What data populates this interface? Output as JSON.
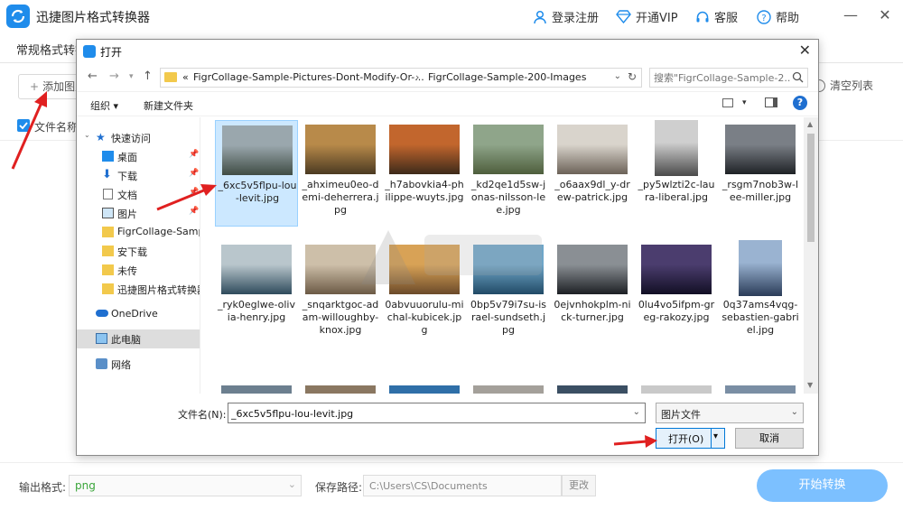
{
  "app": {
    "title": "迅捷图片格式转换器",
    "links": {
      "login": "登录注册",
      "vip": "开通VIP",
      "service": "客服",
      "help": "帮助"
    },
    "tab_label": "常规格式转换",
    "add_button": "添加图片",
    "clear_button": "清空列表",
    "list_header": "文件名称",
    "output_label": "输出格式:",
    "output_value": "png",
    "save_label": "保存路径:",
    "save_path": "C:\\Users\\CS\\Documents",
    "change_button": "更改",
    "start_button": "开始转换"
  },
  "dialog": {
    "title": "打开",
    "breadcrumb": {
      "prefix": "«",
      "part1": "FigrCollage-Sample-Pictures-Dont-Modify-Or-...",
      "sep": "›",
      "part2": "FigrCollage-Sample-200-Images"
    },
    "search_placeholder": "搜索\"FigrCollage-Sample-2...",
    "organize": "组织 ▾",
    "new_folder": "新建文件夹",
    "help_glyph": "?",
    "nav": [
      {
        "label": "快速访问",
        "icon": "star-icon"
      },
      {
        "label": "桌面",
        "icon": "desktop-icon",
        "pinned": true
      },
      {
        "label": "下载",
        "icon": "download-icon",
        "pinned": true
      },
      {
        "label": "文档",
        "icon": "document-icon",
        "pinned": true
      },
      {
        "label": "图片",
        "icon": "picture-icon",
        "pinned": true
      },
      {
        "label": "FigrCollage-Samp",
        "icon": "folder-icon"
      },
      {
        "label": "安下载",
        "icon": "folder-icon"
      },
      {
        "label": "未传",
        "icon": "folder-icon"
      },
      {
        "label": "迅捷图片格式转换器",
        "icon": "folder-icon"
      },
      {
        "label": "OneDrive",
        "icon": "cloud-icon"
      },
      {
        "label": "此电脑",
        "icon": "computer-icon",
        "selected": true
      },
      {
        "label": "网络",
        "icon": "network-icon"
      }
    ],
    "files": [
      {
        "name": "_6xc5v5flpu-lou-levit.jpg",
        "selected": true,
        "colors": [
          "#9aa7ad",
          "#3f4c44"
        ]
      },
      {
        "name": "_ahximeu0eo-demi-deherrera.jpg",
        "colors": [
          "#b88a4a",
          "#4b3a22"
        ]
      },
      {
        "name": "_h7abovkia4-philippe-wuyts.jpg",
        "colors": [
          "#c2662d",
          "#3d2a1a"
        ]
      },
      {
        "name": "_kd2qe1d5sw-jonas-nilsson-lee.jpg",
        "colors": [
          "#8fa58a",
          "#4e5e3c"
        ]
      },
      {
        "name": "_o6aax9dl_y-drew-patrick.jpg",
        "colors": [
          "#d9d4cc",
          "#6c6258"
        ]
      },
      {
        "name": "_py5wlzti2c-laura-liberal.jpg",
        "colors": [
          "#cfcfcf",
          "#4a4a4a"
        ]
      },
      {
        "name": "_rsgm7nob3w-lee-miller.jpg",
        "colors": [
          "#7a7f86",
          "#1f2226"
        ]
      },
      {
        "name": "_ryk0eglwe-olivia-henry.jpg",
        "colors": [
          "#b9c6cc",
          "#2f4b5c"
        ]
      },
      {
        "name": "_snqarktgoc-adam-willoughby-knox.jpg",
        "colors": [
          "#cdbfa9",
          "#6c5a45"
        ]
      },
      {
        "name": "0abvuuorulu-michal-kubicek.jpg",
        "colors": [
          "#d8a256",
          "#6b4a2a"
        ]
      },
      {
        "name": "0bp5v79i7su-israel-sundseth.jpg",
        "colors": [
          "#6fa6c8",
          "#214a66"
        ]
      },
      {
        "name": "0ejvnhokplm-nick-turner.jpg",
        "colors": [
          "#8a8f94",
          "#1d2024"
        ]
      },
      {
        "name": "0lu4vo5ifpm-greg-rakozy.jpg",
        "colors": [
          "#4b3d6e",
          "#120f24"
        ]
      },
      {
        "name": "0q37ams4vqg-sebastien-gabriel.jpg",
        "colors": [
          "#9ab3d1",
          "#2a3c58"
        ]
      }
    ],
    "filename_label": "文件名(N):",
    "filename_value": "_6xc5v5flpu-lou-levit.jpg",
    "filetype_value": "图片文件",
    "open_button": "打开(O)",
    "cancel_button": "取消"
  }
}
